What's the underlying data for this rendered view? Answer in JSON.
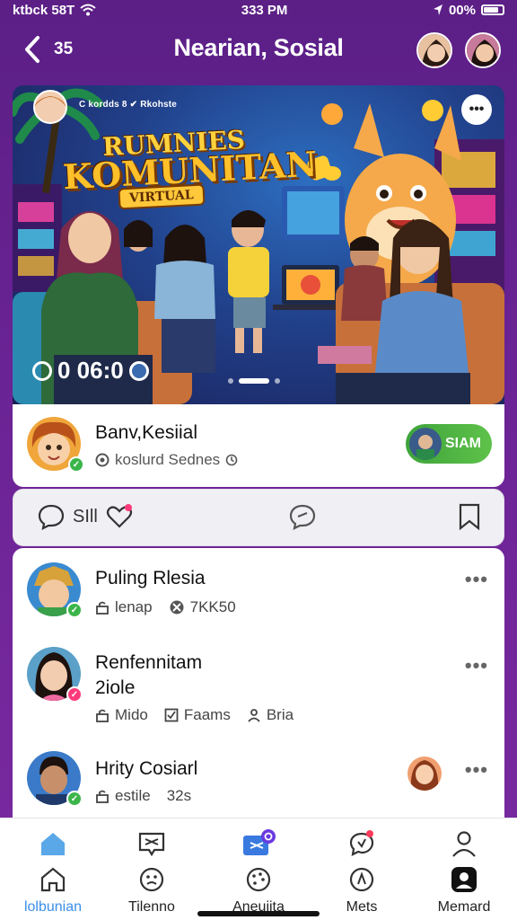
{
  "status": {
    "carrier": "ktbck 58T",
    "time": "333 PM",
    "battery": "00%"
  },
  "header": {
    "back_count": "35",
    "title": "Nearian, Sosial"
  },
  "banner": {
    "top_label": "C kordds 8 ✔ Rkohste",
    "title_line1": "RUMNIES",
    "title_line2": "KOMUNITAN",
    "title_line3": "VIRTUAL",
    "counter": "0 06:0",
    "pager_count": 3,
    "pager_active": 1
  },
  "author": {
    "name": "Banv,Kesiial",
    "subtitle": "koslurd Sednes",
    "join_label": "SIAM"
  },
  "actions": {
    "comment_count": "SIll"
  },
  "feed": {
    "items": [
      {
        "name": "Puling Rlesia",
        "meta": [
          "lenap",
          "7KK50"
        ]
      },
      {
        "name_line1": "Renfennitam",
        "name_line2": "2iole",
        "meta": [
          "Mido",
          "Faams",
          "Bria"
        ]
      },
      {
        "name": "Hrity Cosiarl",
        "meta": [
          "estile",
          "32s"
        ]
      }
    ]
  },
  "nav": {
    "items": [
      {
        "label": "lolbunian",
        "active": true
      },
      {
        "label": "Tilenno",
        "active": false
      },
      {
        "label": "Aneuiita",
        "active": false
      },
      {
        "label": "Mets",
        "active": false
      },
      {
        "label": "Memard",
        "active": false
      }
    ]
  },
  "colors": {
    "header_bg": "#5b1f86",
    "accent_green": "#3bb54a",
    "active_nav": "#3a8ee8"
  }
}
